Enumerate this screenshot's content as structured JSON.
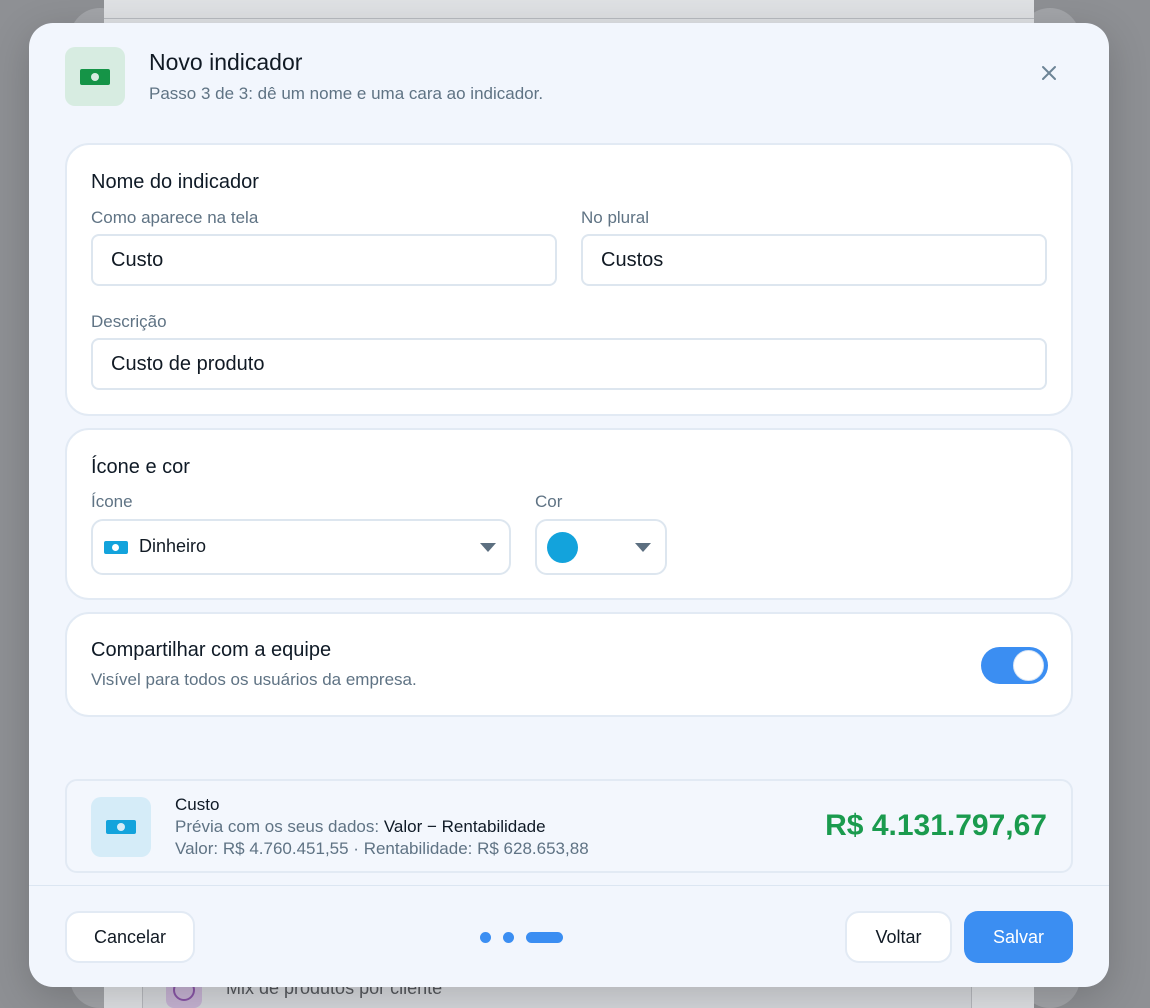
{
  "modal": {
    "title": "Novo indicador",
    "subtitle": "Passo 3 de 3: dê um nome e uma cara ao indicador.",
    "header_icon": "money-icon",
    "close_icon": "close-icon"
  },
  "name_section": {
    "title": "Nome do indicador",
    "singular_label": "Como aparece na tela",
    "singular_value": "Custo",
    "plural_label": "No plural",
    "plural_value": "Custos",
    "description_label": "Descrição",
    "description_value": "Custo de produto"
  },
  "icon_section": {
    "title": "Ícone e cor",
    "icon_label": "Ícone",
    "icon_value": "Dinheiro",
    "color_label": "Cor",
    "color_value": "#13a3dc"
  },
  "share_section": {
    "title": "Compartilhar com a equipe",
    "subtitle": "Visível para todos os usuários da empresa.",
    "enabled": true
  },
  "preview": {
    "name": "Custo",
    "prefix": "Prévia com os seus dados: ",
    "formula": "Valor − Rentabilidade",
    "values": "Valor: R$ 4.760.451,55  ·  Rentabilidade: R$ 628.653,88",
    "total": "R$ 4.131.797,67"
  },
  "footer": {
    "cancel_label": "Cancelar",
    "back_label": "Voltar",
    "save_label": "Salvar",
    "step": 3,
    "step_count": 3
  },
  "background": {
    "item_label": "Mix de produtos por cliente"
  },
  "colors": {
    "primary": "#3b8ef2",
    "positive": "#1a9b4e",
    "header_icon_bg": "#d7ece1",
    "header_icon": "#159447"
  }
}
